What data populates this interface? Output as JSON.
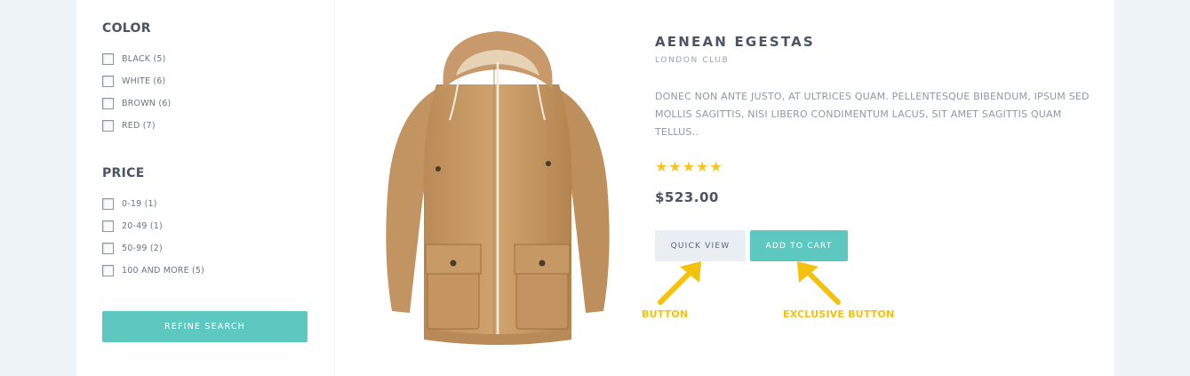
{
  "filters": {
    "color": {
      "title": "COLOR",
      "options": [
        {
          "label": "BLACK (5)"
        },
        {
          "label": "WHITE (6)"
        },
        {
          "label": "BROWN (6)"
        },
        {
          "label": "RED (7)"
        }
      ]
    },
    "price": {
      "title": "PRICE",
      "options": [
        {
          "label": "0-19 (1)"
        },
        {
          "label": "20-49 (1)"
        },
        {
          "label": "50-99 (2)"
        },
        {
          "label": "100 AND MORE (5)"
        }
      ]
    },
    "refine_label": "REFINE SEARCH"
  },
  "product": {
    "image_icon": "jacket-image",
    "name": "AENEAN EGESTAS",
    "brand": "LONDON CLUB",
    "description": "DONEC NON ANTE JUSTO, AT ULTRICES QUAM. PELLENTESQUE BIBENDUM, IPSUM SED MOLLIS SAGITTIS, NISI LIBERO CONDIMENTUM LACUS, SIT AMET SAGITTIS QUAM TELLUS..",
    "rating": 5,
    "rating_max": 5,
    "price": "$523.00",
    "quick_view_label": "QUICK VIEW",
    "add_to_cart_label": "ADD TO CART"
  },
  "annotations": {
    "button_label": "BUTTON",
    "exclusive_label": "EXCLUSIVE BUTTON"
  },
  "colors": {
    "accent": "#5cc8c0",
    "star": "#f7c51d",
    "annotation": "#f4c20d",
    "heading": "#4a5563",
    "background": "#eef3f7"
  }
}
